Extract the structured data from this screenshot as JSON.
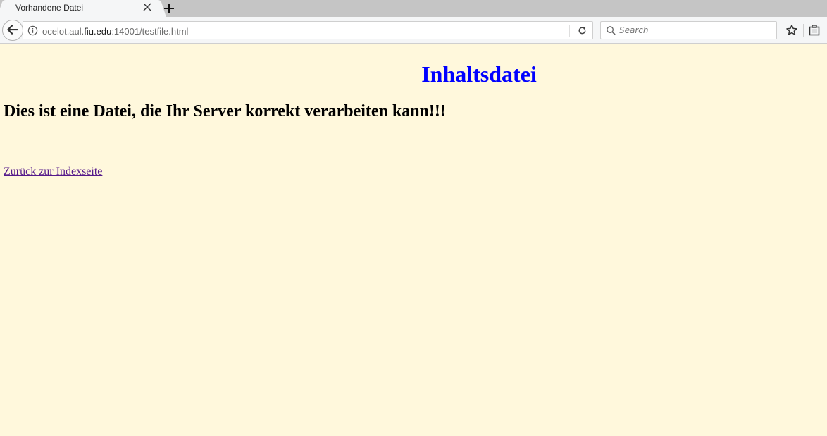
{
  "browser": {
    "tab": {
      "title": "Vorhandene Datei"
    },
    "url": {
      "host_prefix": "ocelot.aul.",
      "host_domain": "fiu.edu",
      "rest": ":14001/testfile.html"
    },
    "search": {
      "placeholder": "Search"
    },
    "icons": [
      "close-icon",
      "plus-icon",
      "back-arrow-icon",
      "info-icon",
      "reload-icon",
      "search-icon",
      "star-icon",
      "library-icon"
    ]
  },
  "page": {
    "title": "Inhaltsdatei",
    "subtitle": "Dies ist eine Datei, die Ihr Server korrekt verarbeiten kann!!!",
    "link": "Zurück zur Indexseite"
  },
  "colors": {
    "page_background": "#fff8dc",
    "title": "#0000ff",
    "visited_link": "#551a8b"
  }
}
